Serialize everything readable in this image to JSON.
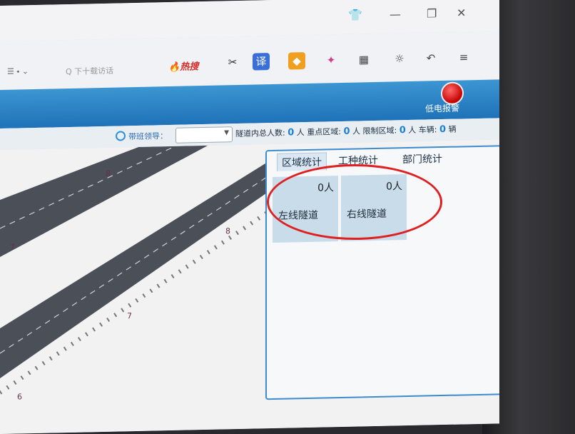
{
  "browser": {
    "hot_label": "热搜",
    "search_placeholder": "Q 下十载访话"
  },
  "header": {
    "alarm_label": "低电报警"
  },
  "statsbar": {
    "leader_label": "带班领导：",
    "total_label": "隧道内总人数:",
    "total_value": "0",
    "person_unit": "人",
    "key_label": "重点区域:",
    "key_value": "0",
    "restricted_label": "限制区域:",
    "restricted_value": "0",
    "vehicle_label": "车辆:",
    "vehicle_value": "0",
    "vehicle_unit": "辆"
  },
  "map": {
    "markers": [
      "8",
      "8",
      "7",
      "7",
      "6"
    ]
  },
  "panel": {
    "tabs": [
      "区域统计",
      "工种统计",
      "部门统计"
    ],
    "regions": [
      {
        "name": "左线隧道",
        "count": "0人"
      },
      {
        "name": "右线隧道",
        "count": "0人"
      }
    ]
  },
  "colors": {
    "accent": "#2f8fd8",
    "header": "#1f72b8",
    "highlight": "#e02020"
  }
}
